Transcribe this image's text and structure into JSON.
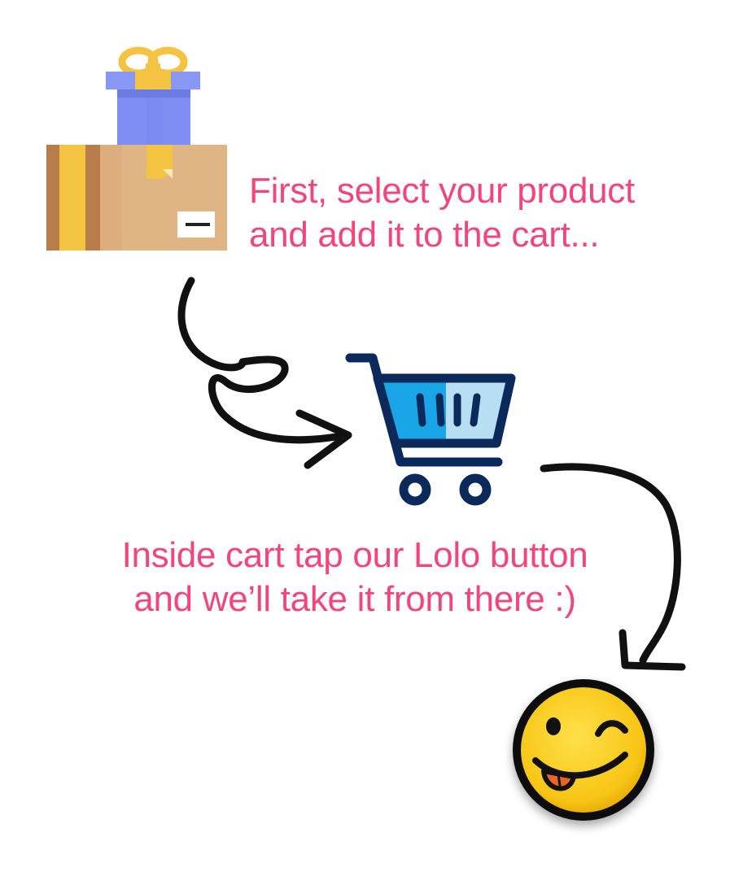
{
  "step1": {
    "line1": "First, select your product",
    "line2": "and add it to the cart..."
  },
  "step2": {
    "line1": "Inside cart tap our Lolo button",
    "line2": "and we’ll take it from there :)"
  },
  "icons": {
    "package": "gift-box-icon",
    "cart": "shopping-cart-icon",
    "emoji": "winking-tongue-emoji-icon"
  },
  "colors": {
    "caption": "#f2457c",
    "cart_outline": "#0b2a5b",
    "cart_fill": "#1aa5e8",
    "gift_blue": "#7f8ef2",
    "ribbon_yellow": "#f5c342",
    "box_tan": "#d9a877",
    "emoji_yellow": "#f7c514"
  }
}
